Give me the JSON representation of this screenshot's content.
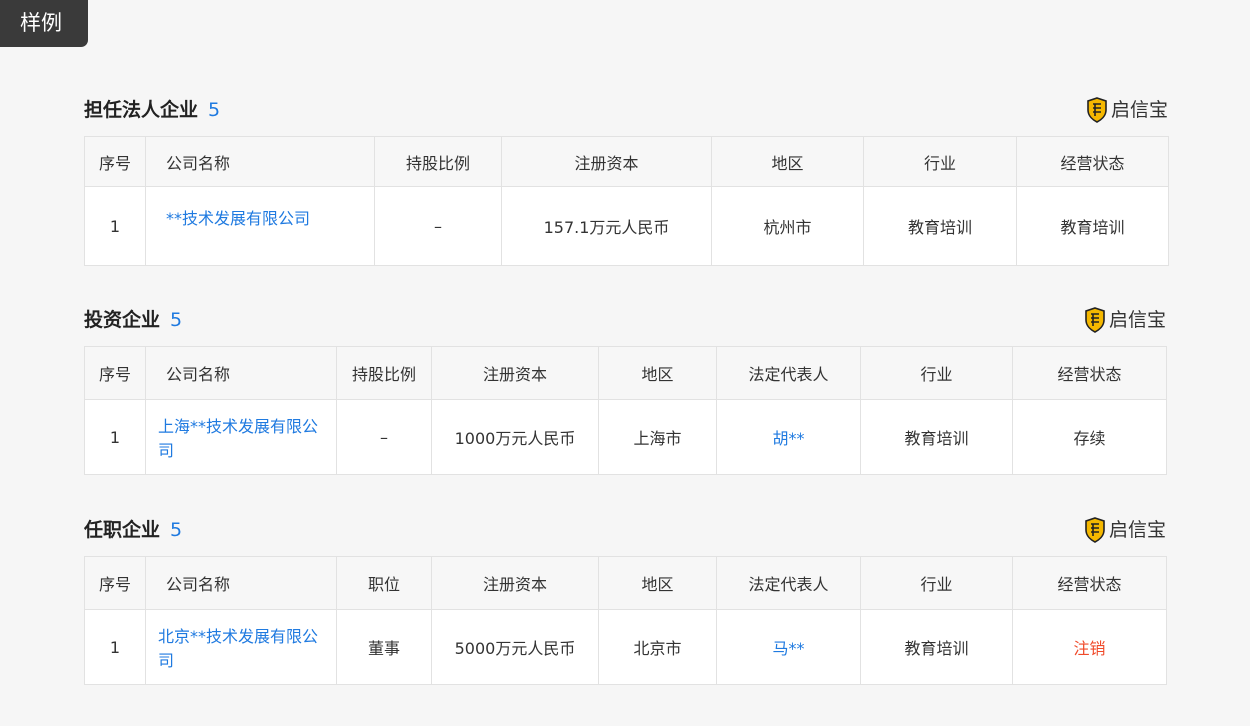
{
  "sample_label": "样例",
  "brand_name": "启信宝",
  "colors": {
    "link": "#1f7ae0",
    "danger": "#f04a2a",
    "tag_bg": "#3a3a3a"
  },
  "sections": [
    {
      "title": "担任法人企业",
      "count": "5",
      "headers": [
        "序号",
        "公司名称",
        "持股比例",
        "注册资本",
        "地区",
        "行业",
        "经营状态"
      ],
      "rows": [
        {
          "index": "1",
          "company": "**技术发展有限公司",
          "share": "–",
          "capital": "157.1万元人民币",
          "region": "杭州市",
          "industry": "教育培训",
          "status": "教育培训"
        }
      ]
    },
    {
      "title": "投资企业",
      "count": "5",
      "headers": [
        "序号",
        "公司名称",
        "持股比例",
        "注册资本",
        "地区",
        "法定代表人",
        "行业",
        "经营状态"
      ],
      "rows": [
        {
          "index": "1",
          "company": "上海**技术发展有限公司",
          "share": "–",
          "capital": "1000万元人民币",
          "region": "上海市",
          "legal_rep": "胡**",
          "industry": "教育培训",
          "status": "存续"
        }
      ]
    },
    {
      "title": "任职企业",
      "count": "5",
      "headers": [
        "序号",
        "公司名称",
        "职位",
        "注册资本",
        "地区",
        "法定代表人",
        "行业",
        "经营状态"
      ],
      "rows": [
        {
          "index": "1",
          "company": "北京**技术发展有限公司",
          "position": "董事",
          "capital": "5000万元人民币",
          "region": "北京市",
          "legal_rep": "马**",
          "industry": "教育培训",
          "status": "注销"
        }
      ]
    }
  ]
}
